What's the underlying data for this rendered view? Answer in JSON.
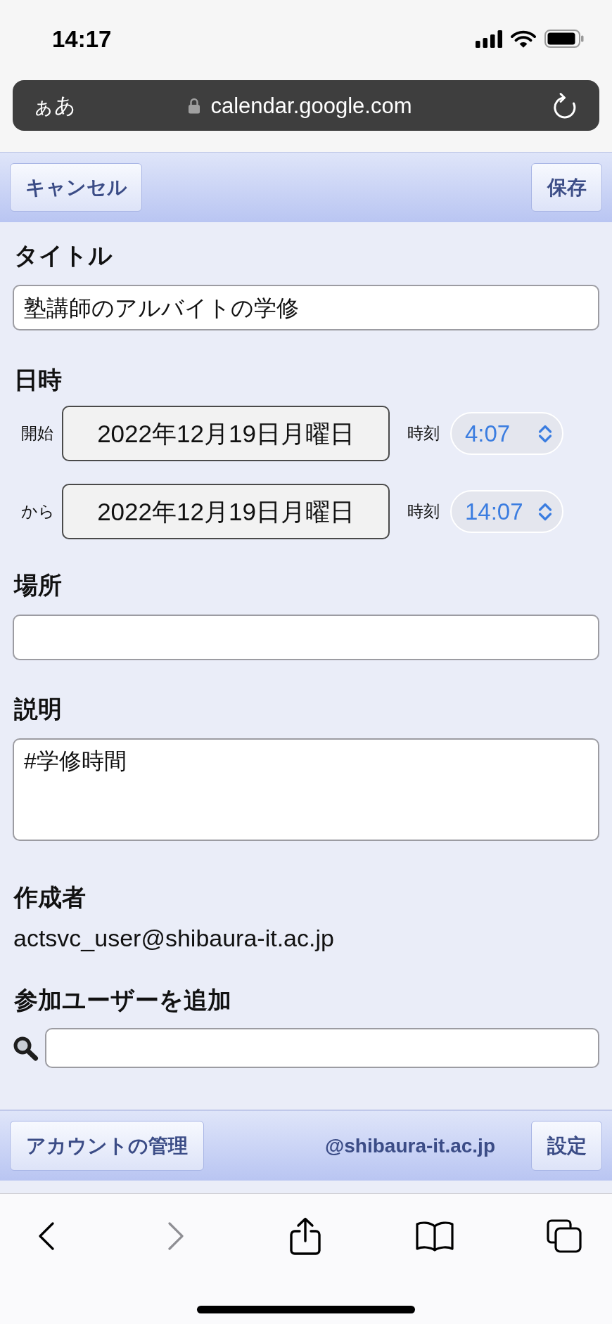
{
  "status_bar": {
    "time": "14:17"
  },
  "address_bar": {
    "text_size": "ぁあ",
    "url": "calendar.google.com"
  },
  "header": {
    "cancel": "キャンセル",
    "save": "保存"
  },
  "form": {
    "title": {
      "label": "タイトル",
      "value": "塾講師のアルバイトの学修"
    },
    "datetime": {
      "label": "日時",
      "rows": [
        {
          "label": "開始",
          "date": "2022年12月19日月曜日",
          "time_label": "時刻",
          "time": "4:07"
        },
        {
          "label": "から",
          "date": "2022年12月19日月曜日",
          "time_label": "時刻",
          "time": "14:07"
        }
      ]
    },
    "location": {
      "label": "場所"
    },
    "description": {
      "label": "説明",
      "value": "#学修時間"
    },
    "creator": {
      "label": "作成者",
      "value": "actsvc_user@shibaura-it.ac.jp"
    },
    "guests": {
      "label": "参加ユーザーを追加"
    }
  },
  "footer": {
    "account": "アカウントの管理",
    "domain": "@shibaura-it.ac.jp",
    "settings": "設定"
  },
  "toolbar": [
    {
      "kind": "back",
      "disabled": false
    },
    {
      "kind": "forward",
      "disabled": true
    },
    {
      "kind": "share",
      "disabled": false
    },
    {
      "kind": "bookmarks",
      "disabled": false
    },
    {
      "kind": "tabs",
      "disabled": false
    }
  ]
}
